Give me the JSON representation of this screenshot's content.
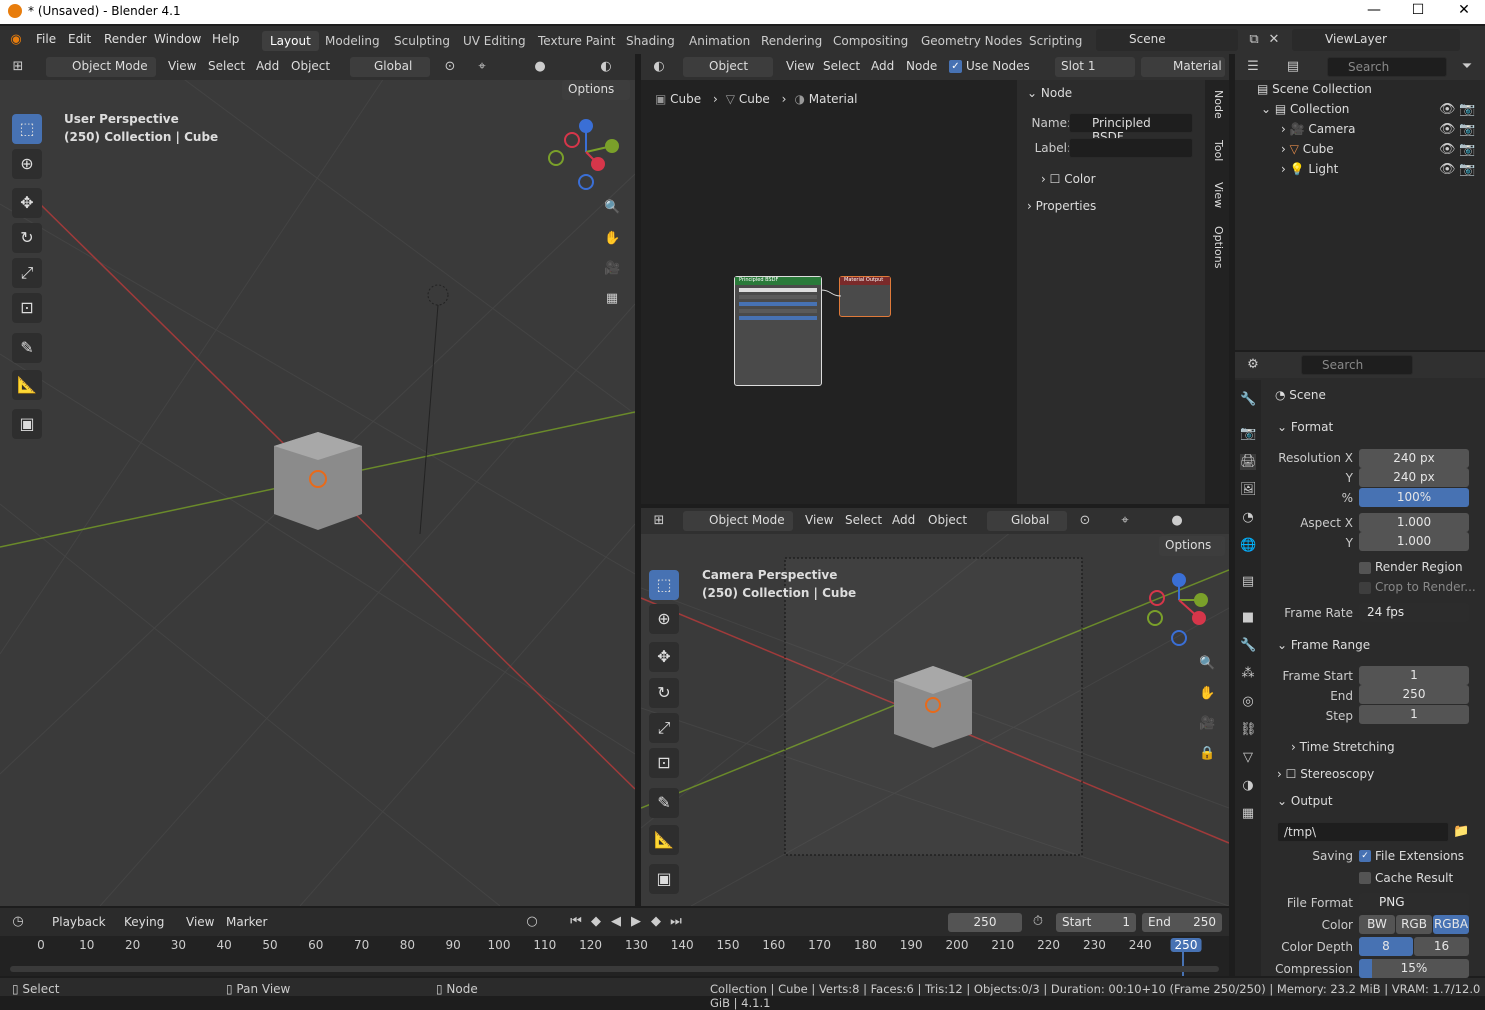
{
  "window": {
    "title": "* (Unsaved) - Blender 4.1"
  },
  "menu": [
    "File",
    "Edit",
    "Render",
    "Window",
    "Help"
  ],
  "workspaces": [
    "Layout",
    "Modeling",
    "Sculpting",
    "UV Editing",
    "Texture Paint",
    "Shading",
    "Animation",
    "Rendering",
    "Compositing",
    "Geometry Nodes",
    "Scripting"
  ],
  "scene": {
    "name": "Scene",
    "view_layer": "ViewLayer"
  },
  "viewport_left": {
    "mode": "Object Mode",
    "menus": [
      "View",
      "Select",
      "Add",
      "Object"
    ],
    "orientation": "Global",
    "options": "Options",
    "overlay_title": "User Perspective",
    "overlay_sub": "(250) Collection | Cube"
  },
  "node_editor": {
    "type": "Object",
    "menus": [
      "View",
      "Select",
      "Add",
      "Node"
    ],
    "use_nodes": "Use Nodes",
    "slot": "Slot 1",
    "material": "Material",
    "breadcrumb": [
      "Cube",
      "Cube",
      "Material"
    ],
    "panel_title": "Node",
    "name_label": "Name:",
    "name_value": "Principled BSDF",
    "label_label": "Label:",
    "color_section": "Color",
    "properties_section": "Properties",
    "tabs": [
      "Node",
      "Tool",
      "View",
      "Options"
    ],
    "node1": "Principled BSDF",
    "node2": "Material Output"
  },
  "viewport_right": {
    "mode": "Object Mode",
    "menus": [
      "View",
      "Select",
      "Add",
      "Object"
    ],
    "orientation": "Global",
    "options": "Options",
    "overlay_title": "Camera Perspective",
    "overlay_sub": "(250) Collection | Cube"
  },
  "outliner": {
    "search": "Search",
    "root": "Scene Collection",
    "collection": "Collection",
    "items": [
      "Camera",
      "Cube",
      "Light"
    ]
  },
  "properties": {
    "search": "Search",
    "scene": "Scene",
    "format": "Format",
    "res_x_label": "Resolution X",
    "res_x": "240 px",
    "res_y_label": "Y",
    "res_y": "240 px",
    "pct_label": "%",
    "pct": "100%",
    "aspect_x_label": "Aspect X",
    "aspect_x": "1.000",
    "aspect_y_label": "Y",
    "aspect_y": "1.000",
    "render_region": "Render Region",
    "crop": "Crop to Render...",
    "frame_rate_label": "Frame Rate",
    "frame_rate": "24 fps",
    "frame_range": "Frame Range",
    "frame_start_label": "Frame Start",
    "frame_start": "1",
    "end_label": "End",
    "end": "250",
    "step_label": "Step",
    "step": "1",
    "time_stretching": "Time Stretching",
    "stereoscopy": "Stereoscopy",
    "output": "Output",
    "path": "/tmp\\",
    "saving_label": "Saving",
    "file_ext": "File Extensions",
    "cache": "Cache Result",
    "file_format_label": "File Format",
    "file_format": "PNG",
    "color_label": "Color",
    "color_opts": [
      "BW",
      "RGB",
      "RGBA"
    ],
    "depth_label": "Color Depth",
    "depth_opts": [
      "8",
      "16"
    ],
    "compression_label": "Compression",
    "compression": "15%"
  },
  "timeline": {
    "menus": [
      "Playback",
      "Keying",
      "View",
      "Marker"
    ],
    "current": "250",
    "start_label": "Start",
    "start": "1",
    "end_label": "End",
    "end": "250",
    "ticks": [
      "0",
      "10",
      "20",
      "30",
      "40",
      "50",
      "60",
      "70",
      "80",
      "90",
      "100",
      "110",
      "120",
      "130",
      "140",
      "150",
      "160",
      "170",
      "180",
      "190",
      "200",
      "210",
      "220",
      "230",
      "240",
      "250"
    ]
  },
  "statusbar": {
    "select": "Select",
    "pan": "Pan View",
    "node": "Node",
    "info": "Collection | Cube | Verts:8 | Faces:6 | Tris:12 | Objects:0/3 | Duration: 00:10+10 (Frame 250/250) | Memory: 23.2 MiB | VRAM: 1.7/12.0 GiB | 4.1.1"
  }
}
